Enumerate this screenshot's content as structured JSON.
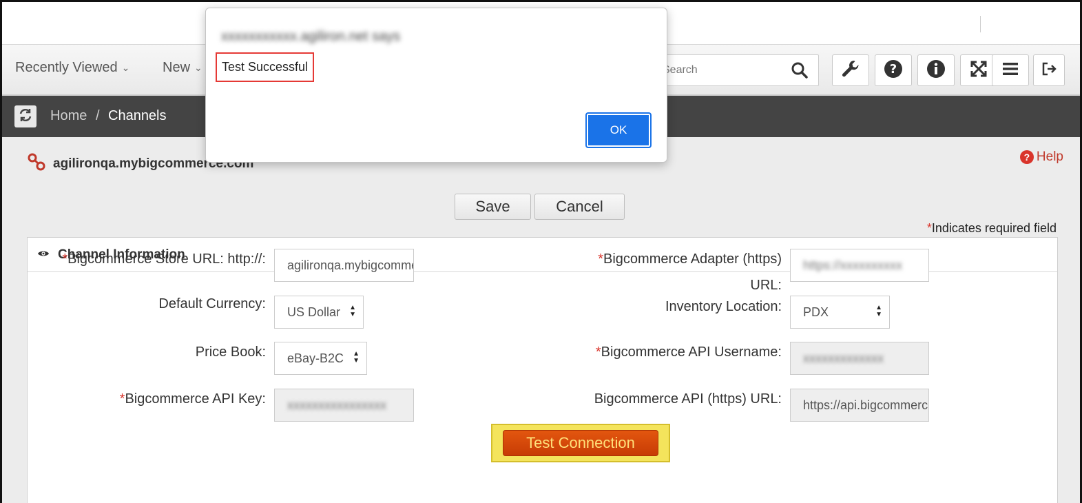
{
  "nav": {
    "recently_viewed": "Recently Viewed",
    "new": "New",
    "search_placeholder": "Search"
  },
  "breadcrumb": {
    "home": "Home",
    "separator": "/",
    "current": "Channels"
  },
  "store": {
    "title": "agilironqa.mybigcommerce.com",
    "help": "Help"
  },
  "actions": {
    "save": "Save",
    "cancel": "Cancel",
    "required_asterisk": "*",
    "required_note": "Indicates required field"
  },
  "panel": {
    "title": "Channel Information",
    "fields": {
      "store_url": {
        "required": "*",
        "label": "Bigcommerce Store URL: http://:",
        "value": "agilironqa.mybigcommerce.com"
      },
      "default_currency": {
        "label": "Default Currency:",
        "value": "US Dollar"
      },
      "price_book": {
        "label": "Price Book:",
        "value": "eBay-B2C"
      },
      "api_key": {
        "required": "*",
        "label": "Bigcommerce API Key:",
        "value": "xxxxxxxxxxxxxxxx"
      },
      "adapter_url": {
        "required": "*",
        "label_line1": "Bigcommerce Adapter (https)",
        "label_line2": "URL:",
        "value": "https://xxxxxxxxxx"
      },
      "inventory_location": {
        "label": "Inventory Location:",
        "value": "PDX"
      },
      "api_username": {
        "required": "*",
        "label": "Bigcommerce API Username:",
        "value": "xxxxxxxxxxxxx"
      },
      "api_url": {
        "label": "Bigcommerce API (https) URL:",
        "value": "https://api.bigcommerce.com"
      }
    },
    "test_connection": "Test Connection"
  },
  "dialog": {
    "origin": "xxxxxxxxxxx.agiliron.net says",
    "message": "Test Successful",
    "ok": "OK"
  },
  "colors": {
    "required": "#d9342b",
    "test_button": "#d9490a",
    "ok_button": "#1a73e8",
    "breadcrumb_bar": "#444444"
  }
}
